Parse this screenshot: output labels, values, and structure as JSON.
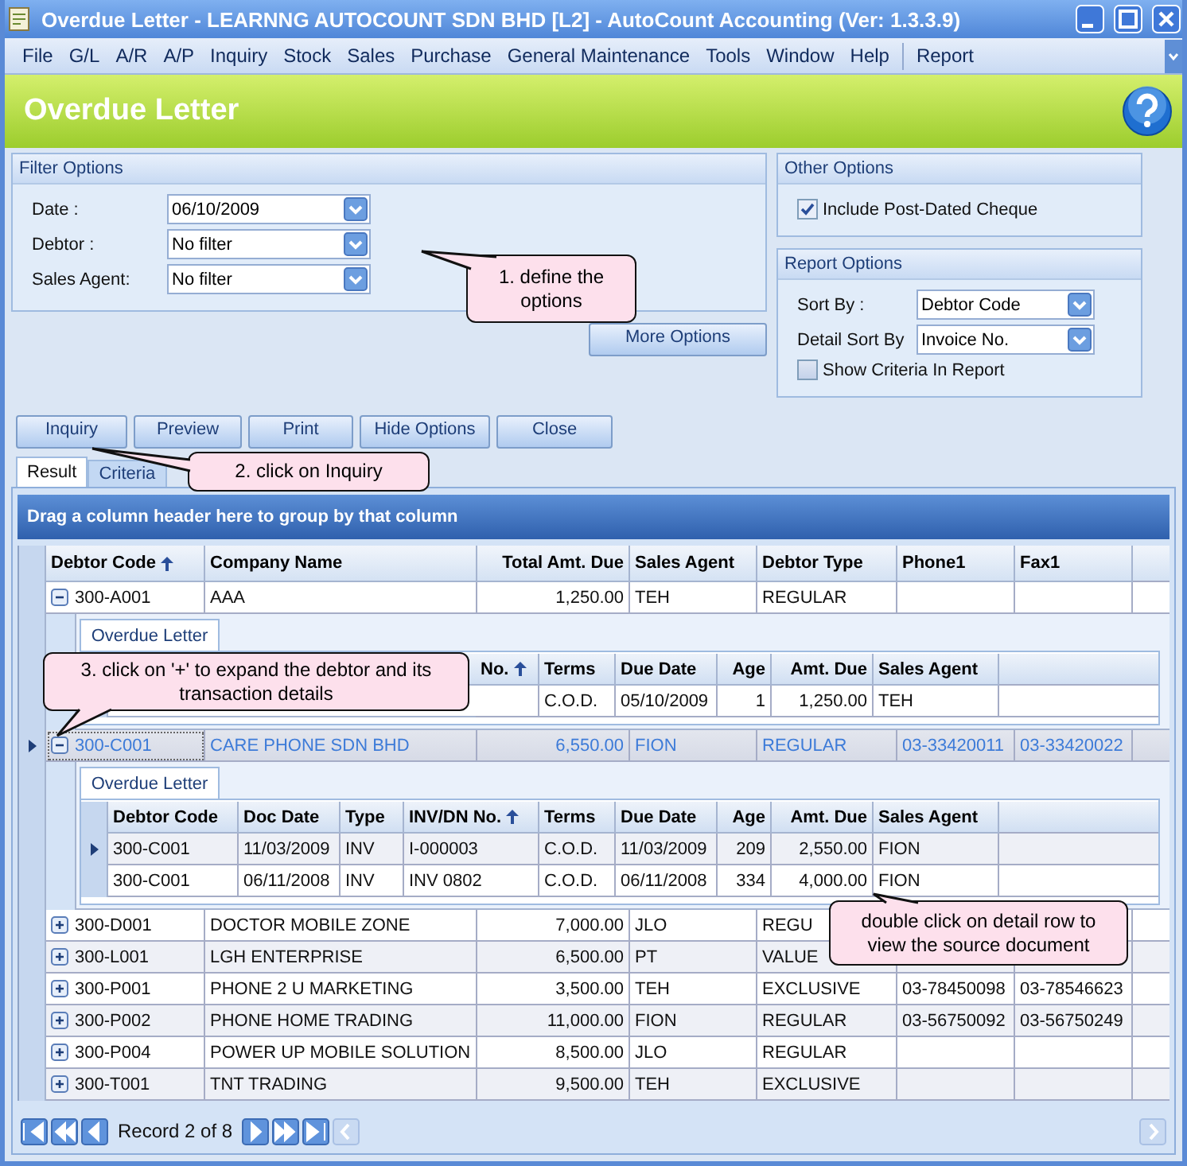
{
  "window": {
    "title": "Overdue Letter - LEARNNG AUTOCOUNT SDN BHD [L2] - AutoCount Accounting (Ver: 1.3.3.9)"
  },
  "menu": [
    "File",
    "G/L",
    "A/R",
    "A/P",
    "Inquiry",
    "Stock",
    "Sales",
    "Purchase",
    "General Maintenance",
    "Tools",
    "Window",
    "Help",
    "Report"
  ],
  "header": {
    "title": "Overdue Letter"
  },
  "filter_options": {
    "title": "Filter Options",
    "fields": [
      {
        "label": "Date :",
        "value": "06/10/2009"
      },
      {
        "label": "Debtor :",
        "value": "No filter"
      },
      {
        "label": "Sales Agent:",
        "value": "No filter"
      }
    ],
    "more_button": "More Options"
  },
  "other_options": {
    "title": "Other Options",
    "checkboxes": [
      {
        "label": "Include Post-Dated Cheque",
        "checked": true
      }
    ]
  },
  "report_options": {
    "title": "Report Options",
    "fields": [
      {
        "label": "Sort By :",
        "value": "Debtor Code"
      },
      {
        "label": "Detail Sort By",
        "value": "Invoice No."
      }
    ],
    "checkboxes": [
      {
        "label": "Show Criteria In Report",
        "checked": false
      }
    ]
  },
  "actions": [
    "Inquiry",
    "Preview",
    "Print",
    "Hide Options",
    "Close"
  ],
  "tabs": [
    {
      "label": "Result",
      "selected": true
    },
    {
      "label": "Criteria",
      "selected": false
    }
  ],
  "grid": {
    "group_hint": "Drag a column header here to group by that column",
    "columns": [
      {
        "label": "Debtor Code",
        "sorted": true
      },
      {
        "label": "Company Name",
        "sorted": false
      },
      {
        "label": "Total Amt. Due",
        "sorted": false
      },
      {
        "label": "Sales Agent",
        "sorted": false
      },
      {
        "label": "Debtor Type",
        "sorted": false
      },
      {
        "label": "Phone1",
        "sorted": false
      },
      {
        "label": "Fax1",
        "sorted": false
      }
    ],
    "rows": [
      {
        "cells": [
          "300-A001",
          "AAA",
          "1,250.00",
          "TEH",
          "REGULAR"
        ],
        "expanded": true,
        "selected": false,
        "detail": {
          "tab": "Overdue Letter",
          "columns": [
            {
              "label": "No.",
              "sorted": true
            },
            {
              "label": "Terms",
              "sorted": false
            },
            {
              "label": "Due Date",
              "sorted": false
            },
            {
              "label": "Age",
              "sorted": false,
              "numeric": true
            },
            {
              "label": "Amt. Due",
              "sorted": false,
              "numeric": true
            },
            {
              "label": "Sales Agent",
              "sorted": false
            }
          ],
          "rows": [
            {
              "cells": [
                "",
                "C.O.D.",
                "05/10/2009",
                "1",
                "1,250.00",
                "TEH"
              ],
              "selected": false
            }
          ]
        }
      },
      {
        "cells": [
          "300-C001",
          "CARE PHONE SDN BHD",
          "6,550.00",
          "FION",
          "REGULAR",
          "03-33420011",
          "03-33420022"
        ],
        "expanded": true,
        "selected": true,
        "detail": {
          "tab": "Overdue Letter",
          "columns": [
            {
              "label": "Debtor Code",
              "sorted": false
            },
            {
              "label": "Doc Date",
              "sorted": false
            },
            {
              "label": "Type",
              "sorted": false
            },
            {
              "label": "INV/DN No.",
              "sorted": true
            },
            {
              "label": "Terms",
              "sorted": false
            },
            {
              "label": "Due Date",
              "sorted": false
            },
            {
              "label": "Age",
              "sorted": false,
              "numeric": true
            },
            {
              "label": "Amt. Due",
              "sorted": false,
              "numeric": true
            },
            {
              "label": "Sales Agent",
              "sorted": false
            }
          ],
          "rows": [
            {
              "cells": [
                "300-C001",
                "11/03/2009",
                "INV",
                "I-000003",
                "C.O.D.",
                "11/03/2009",
                "209",
                "2,550.00",
                "FION"
              ],
              "selected": true
            },
            {
              "cells": [
                "300-C001",
                "06/11/2008",
                "INV",
                "INV 0802",
                "C.O.D.",
                "06/11/2008",
                "334",
                "4,000.00",
                "FION"
              ],
              "selected": false
            }
          ]
        }
      },
      {
        "cells": [
          "300-D001",
          "DOCTOR MOBILE ZONE",
          "7,000.00",
          "JLO",
          "REGU"
        ],
        "expanded": false,
        "selected": false
      },
      {
        "cells": [
          "300-L001",
          "LGH ENTERPRISE",
          "6,500.00",
          "PT",
          "VALUE"
        ],
        "expanded": false,
        "selected": false
      },
      {
        "cells": [
          "300-P001",
          "PHONE 2 U MARKETING",
          "3,500.00",
          "TEH",
          "EXCLUSIVE",
          "03-78450098",
          "03-78546623"
        ],
        "expanded": false,
        "selected": false
      },
      {
        "cells": [
          "300-P002",
          "PHONE HOME TRADING",
          "11,000.00",
          "FION",
          "REGULAR",
          "03-56750092",
          "03-56750249"
        ],
        "expanded": false,
        "selected": false
      },
      {
        "cells": [
          "300-P004",
          "POWER UP MOBILE SOLUTION",
          "8,500.00",
          "JLO",
          "REGULAR"
        ],
        "expanded": false,
        "selected": false
      },
      {
        "cells": [
          "300-T001",
          "TNT TRADING",
          "9,500.00",
          "TEH",
          "EXCLUSIVE"
        ],
        "expanded": false,
        "selected": false
      }
    ]
  },
  "navigator": {
    "record": "Record 2 of 8"
  },
  "callouts": [
    {
      "text": "1. define the options"
    },
    {
      "text": "2. click on Inquiry"
    },
    {
      "text": "3. click on '+' to expand the debtor and its transaction details"
    },
    {
      "text": "double click on detail row to view the source document"
    }
  ]
}
